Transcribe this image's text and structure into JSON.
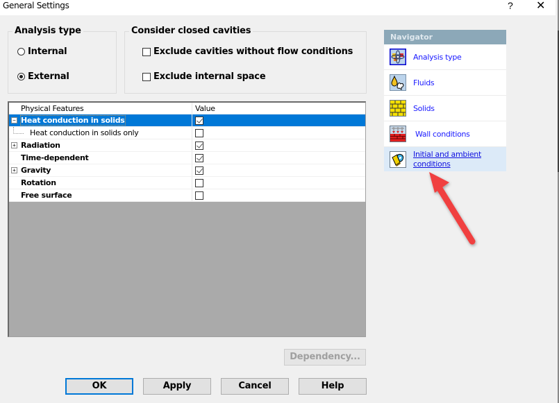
{
  "window": {
    "title": "General Settings",
    "help_label": "?",
    "close_label": "✕"
  },
  "analysis_type": {
    "legend": "Analysis type",
    "options": [
      {
        "label": "Internal",
        "selected": false
      },
      {
        "label": "External",
        "selected": true
      }
    ]
  },
  "closed_cavities": {
    "legend": "Consider closed cavities",
    "options": [
      {
        "label": "Exclude cavities without flow conditions",
        "checked": false
      },
      {
        "label": "Exclude internal space",
        "checked": false
      }
    ]
  },
  "features_grid": {
    "columns": [
      "Physical Features",
      "Value"
    ],
    "rows": [
      {
        "label": "Heat conduction in solids",
        "bold": true,
        "expander": "minus",
        "checked": true,
        "selected": true,
        "level": 0
      },
      {
        "label": "Heat conduction in solids only",
        "bold": false,
        "expander": "none",
        "checked": false,
        "selected": false,
        "level": 1
      },
      {
        "label": "Radiation",
        "bold": true,
        "expander": "plus",
        "checked": true,
        "selected": false,
        "level": 0
      },
      {
        "label": "Time-dependent",
        "bold": true,
        "expander": "none",
        "checked": true,
        "selected": false,
        "level": 0
      },
      {
        "label": "Gravity",
        "bold": true,
        "expander": "plus",
        "checked": true,
        "selected": false,
        "level": 0
      },
      {
        "label": "Rotation",
        "bold": true,
        "expander": "none",
        "checked": false,
        "selected": false,
        "level": 0
      },
      {
        "label": "Free surface",
        "bold": true,
        "expander": "none",
        "checked": false,
        "selected": false,
        "level": 0
      }
    ]
  },
  "buttons": {
    "dependency": "Dependency...",
    "ok": "OK",
    "apply": "Apply",
    "cancel": "Cancel",
    "help": "Help"
  },
  "navigator": {
    "header": "Navigator",
    "items": [
      {
        "label": "Analysis type",
        "icon": "analysis-type-icon",
        "active": false
      },
      {
        "label": "Fluids",
        "icon": "fluids-icon",
        "active": false
      },
      {
        "label": "Solids",
        "icon": "solids-icon",
        "active": false
      },
      {
        "label": "Wall conditions",
        "icon": "wall-conditions-icon",
        "active": false
      },
      {
        "label": "Initial and ambient conditions",
        "icon": "initial-ambient-icon",
        "active": true
      }
    ]
  },
  "annotation": {
    "arrow_color": "#f04040",
    "target": "Initial and ambient conditions"
  },
  "colors": {
    "selection": "#0078d7",
    "link": "#1a1aff",
    "navigator_header": "#8ca8b8",
    "active_nav_bg": "#dceaf8"
  }
}
